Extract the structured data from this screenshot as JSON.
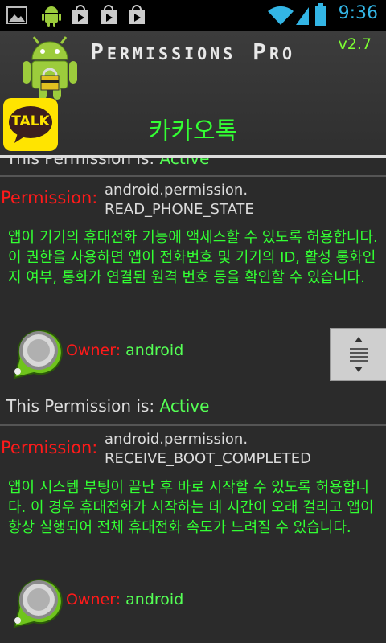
{
  "app": {
    "title": "Permissions Pro",
    "version": "v2.7",
    "selected_app_name": "카카오톡",
    "selected_app_icon_text": "TALK"
  },
  "status_bar": {
    "time": "9:36",
    "icons": [
      "image-icon",
      "android-icon",
      "play-store-icon",
      "play-store-icon",
      "play-store-icon",
      "wifi-icon",
      "battery-icon"
    ]
  },
  "permissions": [
    {
      "status_label": "This Permission is:",
      "status_value": "Active"
    },
    {
      "label": "Permission:",
      "name_line1": "android.permission.",
      "name_line2": "READ_PHONE_STATE",
      "description": "앱이 기기의 휴대전화 기능에 액세스할 수 있도록 허용합니다. 이 권한을 사용하면 앱이 전화번호 및 기기의 ID, 활성 통화인지 여부, 통화가 연결된 원격 번호 등을 확인할 수 있습니다.",
      "owner_label": "Owner:",
      "owner_value": "android",
      "status_label": "This Permission is:",
      "status_value": "Active"
    },
    {
      "label": "Permission:",
      "name_line1": "android.permission.",
      "name_line2": "RECEIVE_BOOT_COMPLETED",
      "description": "앱이 시스템 부팅이 끝난 후 바로 시작할 수 있도록 허용합니다. 이 경우 휴대전화가 시작하는 데 시간이 오래 걸리고 앱이 항상 실행되어 전체 휴대전화 속도가 느려질 수 있습니다.",
      "owner_label": "Owner:",
      "owner_value": "android"
    }
  ]
}
